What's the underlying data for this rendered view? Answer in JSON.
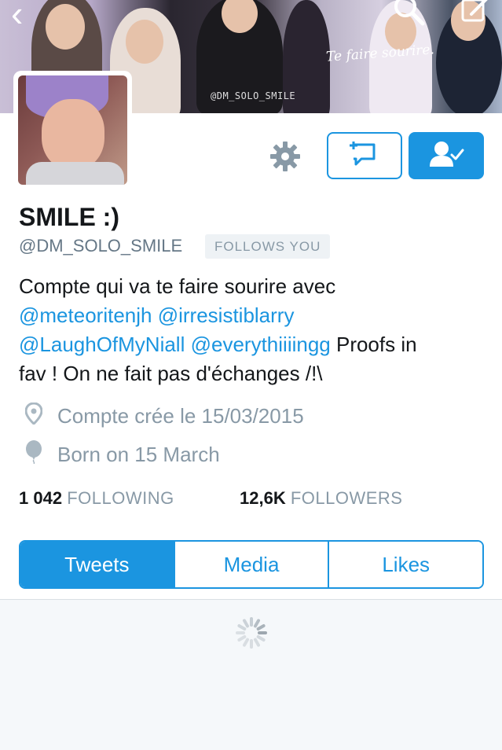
{
  "colors": {
    "accent": "#1b95e0",
    "muted": "#8899a6",
    "text": "#14171a",
    "feed_bg": "#f5f8fa"
  },
  "banner": {
    "script_text": "Te faire sourire.",
    "watermark": "@DM_SOLO_SMILE"
  },
  "nav": {
    "back_icon": "chevron-left-icon",
    "search_icon": "search-icon",
    "compose_icon": "compose-icon"
  },
  "actions": {
    "settings_icon": "gear-icon",
    "message_icon": "direct-message-icon",
    "follow_state_icon": "following-check-icon"
  },
  "profile": {
    "display_name": "SMILE :)",
    "handle": "@DM_SOLO_SMILE",
    "follows_badge": "FOLLOWS YOU",
    "bio": {
      "line1": "Compte qui va te faire sourire avec",
      "mention1": "@meteoritenjh",
      "mention2": "@irresistiblarry",
      "mention3": "@LaughOfMyNiall",
      "mention4": "@everythiiiingg",
      "after_mentions": " Proofs in",
      "line4": "fav ! On ne fait pas d'échanges /!\\"
    },
    "location": "Compte crée le 15/03/2015",
    "birthday": "Born on 15 March"
  },
  "stats": {
    "following_count": "1 042",
    "following_label": "FOLLOWING",
    "followers_count": "12,6K",
    "followers_label": "FOLLOWERS"
  },
  "tabs": [
    {
      "label": "Tweets",
      "active": true
    },
    {
      "label": "Media",
      "active": false
    },
    {
      "label": "Likes",
      "active": false
    }
  ],
  "feed": {
    "loading_icon": "loading-spinner-icon"
  }
}
